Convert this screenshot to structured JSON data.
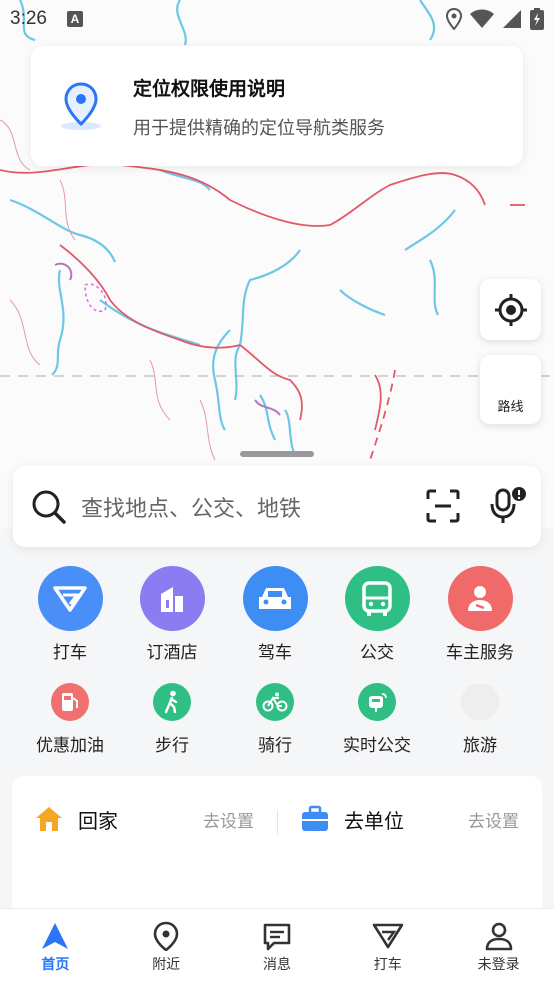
{
  "status_bar": {
    "time": "3:26",
    "a_label": "A"
  },
  "permission_card": {
    "title": "定位权限使用说明",
    "description": "用于提供精确的定位导航类服务"
  },
  "map_controls": {
    "route_label": "路线"
  },
  "search": {
    "placeholder": "查找地点、公交、地铁"
  },
  "services_row1": [
    {
      "label": "打车",
      "icon": "taxi-icon",
      "color": "#4a8ef7"
    },
    {
      "label": "订酒店",
      "icon": "hotel-icon",
      "color": "#8b7cf2"
    },
    {
      "label": "驾车",
      "icon": "car-icon",
      "color": "#3e8df5"
    },
    {
      "label": "公交",
      "icon": "bus-icon",
      "color": "#2fbf85"
    },
    {
      "label": "车主服务",
      "icon": "driver-service-icon",
      "color": "#f06a6a"
    }
  ],
  "services_row2": [
    {
      "label": "优惠加油",
      "icon": "fuel-icon",
      "color": "#f07070"
    },
    {
      "label": "步行",
      "icon": "walk-icon",
      "color": "#2fbf85"
    },
    {
      "label": "骑行",
      "icon": "bike-icon",
      "color": "#2fbf85"
    },
    {
      "label": "实时公交",
      "icon": "realtime-bus-icon",
      "color": "#2fbf85"
    },
    {
      "label": "旅游",
      "icon": "travel-icon",
      "color": "#eeeeee"
    }
  ],
  "home_work": {
    "home_label": "回家",
    "home_set": "去设置",
    "work_label": "去单位",
    "work_set": "去设置"
  },
  "bottom_nav": [
    {
      "label": "首页",
      "icon": "home-nav-icon",
      "active": true
    },
    {
      "label": "附近",
      "icon": "nearby-icon",
      "active": false
    },
    {
      "label": "消息",
      "icon": "message-icon",
      "active": false
    },
    {
      "label": "打车",
      "icon": "taxi-nav-icon",
      "active": false
    },
    {
      "label": "未登录",
      "icon": "user-icon",
      "active": false
    }
  ],
  "colors": {
    "accent": "#2a76f5",
    "border_red": "#e05a67",
    "river": "#6ec6e8"
  }
}
